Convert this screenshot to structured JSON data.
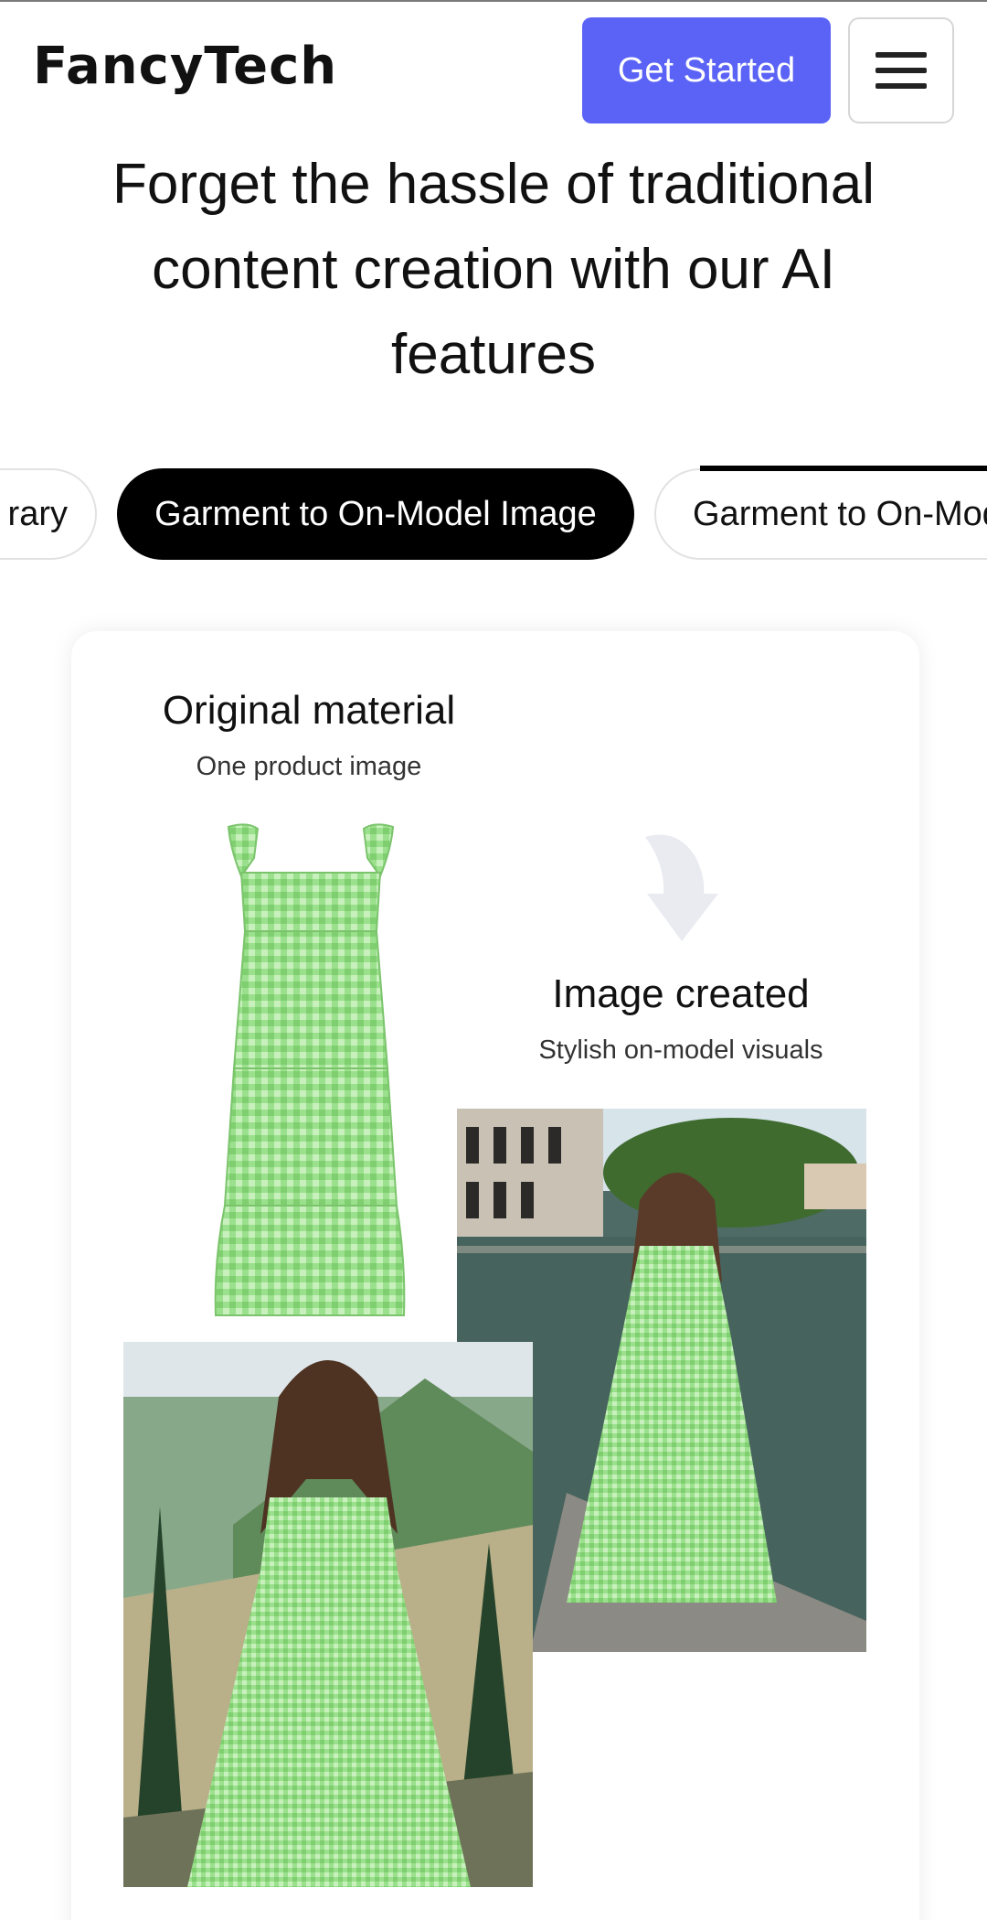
{
  "header": {
    "logo": "FancyTech",
    "cta_label": "Get Started",
    "menu_icon": "hamburger-menu-icon"
  },
  "hero": {
    "headline": "Forget the hassle of traditional content creation with our AI features"
  },
  "tabs": [
    {
      "label": "rary",
      "state": "inactive"
    },
    {
      "label": "Garment to On-Model Image",
      "state": "active"
    },
    {
      "label": "Garment to On-Mod",
      "state": "inactive"
    }
  ],
  "feature_card": {
    "original": {
      "title": "Original material",
      "subtitle": "One product image"
    },
    "created": {
      "title": "Image created",
      "subtitle": "Stylish on-model visuals"
    },
    "arrow_icon": "arrow-down-icon"
  },
  "colors": {
    "cta_background": "#5b63f6",
    "tab_active_background": "#000000",
    "dress_green": "#8fd982"
  }
}
